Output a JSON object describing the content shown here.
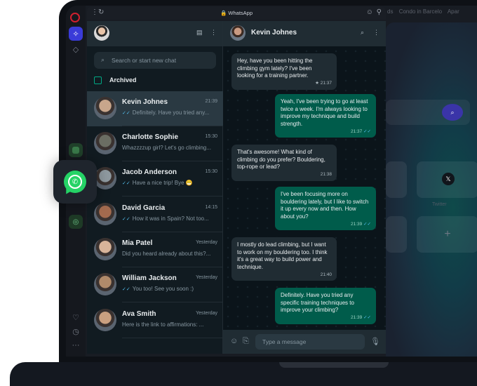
{
  "browser": {
    "tab_title": "WhatsApp",
    "background_tabs": [
      "ds",
      "Condo in Barcelo",
      "Apar"
    ]
  },
  "chat_list": {
    "search_placeholder": "Search or start new chat",
    "archived_label": "Archived",
    "chats": [
      {
        "name": "Kevin Johnes",
        "time": "21:39",
        "preview": "Definitely. Have you tried any...",
        "read_ticks": true,
        "avatar_color": "#c8a68c"
      },
      {
        "name": "Charlotte Sophie",
        "time": "15:30",
        "preview": "Whazzzzup girl? Let's go climbing...",
        "read_ticks": false,
        "avatar_color": "#6b6e63"
      },
      {
        "name": "Jacob Anderson",
        "time": "15:30",
        "preview": "Have a nice trip! Bye 😁",
        "read_ticks": true,
        "avatar_color": "#8f9aa0"
      },
      {
        "name": "David Garcia",
        "time": "14:15",
        "preview": "How it was in Spain? Not too...",
        "read_ticks": true,
        "avatar_color": "#a36a4e"
      },
      {
        "name": "Mia Patel",
        "time": "Yesterday",
        "preview": "Did you heard already about this?...",
        "read_ticks": false,
        "avatar_color": "#d8b49a"
      },
      {
        "name": "William Jackson",
        "time": "Yesterday",
        "preview": "You too! See you soon :)",
        "read_ticks": true,
        "avatar_color": "#b08a6a"
      },
      {
        "name": "Ava Smith",
        "time": "Yesterday",
        "preview": "Here is the link to affirmations: ...",
        "read_ticks": false,
        "avatar_color": "#caa080"
      }
    ]
  },
  "conversation": {
    "contact_name": "Kevin Johnes",
    "composer_placeholder": "Type a message",
    "messages": [
      {
        "direction": "in",
        "text": "Hey, have you been hitting the climbing gym lately? I've been looking for a training partner.",
        "time": "21:37",
        "starred": true
      },
      {
        "direction": "out",
        "text": "Yeah, I've been trying to go at least twice a week. I'm always looking to improve my technique and build strength.",
        "time": "21:37"
      },
      {
        "direction": "in",
        "text": "That's awesome! What kind of climbing do you prefer? Bouldering, top-rope or lead?",
        "time": "21:38"
      },
      {
        "direction": "out",
        "text": "I've been focusing more on bouldering lately, but I like to switch it up every now and then. How about you?",
        "time": "21:39"
      },
      {
        "direction": "in",
        "text": "I mostly do lead climbing, but I want to work on my bouldering too. I think it's a great way to build power and technique.",
        "time": "21:40"
      },
      {
        "direction": "out",
        "text": "Definitely. Have you tried any specific training techniques to improve your climbing?",
        "time": "21:39"
      }
    ]
  },
  "start_page": {
    "tile_label": "Twitter"
  },
  "colors": {
    "accent": "#00a884",
    "outgoing_bubble": "#005c4b",
    "incoming_bubble": "#202c33",
    "whatsapp_green": "#25d366"
  }
}
